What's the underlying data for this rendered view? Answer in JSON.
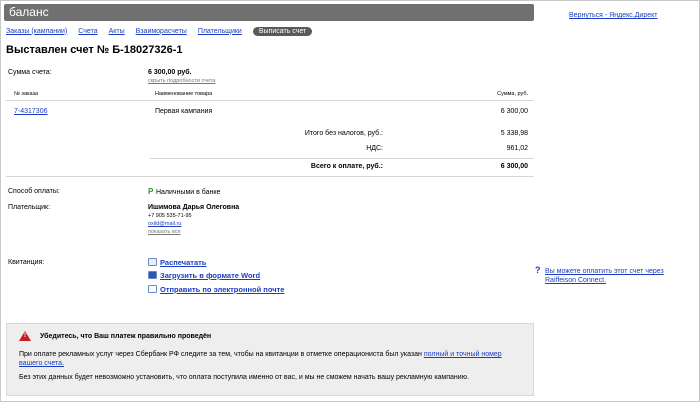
{
  "header": {
    "title": "баланс"
  },
  "back_link": "Вернуться - Яндекс.Директ",
  "nav": {
    "items": [
      "Заказы (кампании)",
      "Счета",
      "Акты",
      "Взаиморасчеты",
      "Плательщики"
    ],
    "active": "Выписать счет"
  },
  "page_title": "Выставлен счет № Б-18027326-1",
  "invoice": {
    "sum_label": "Сумма счета:",
    "sum_value": "6 300,00 руб.",
    "hide_details": "скрыть подробности счета",
    "table": {
      "col_order": "№ заказа",
      "col_name": "Наименование товара",
      "col_sum": "Сумма, руб.",
      "rows": [
        {
          "order": "7-4317306",
          "name": "Первая кампания",
          "sum": "6 300,00"
        }
      ]
    },
    "total_no_tax_label": "Итого без налогов, руб.:",
    "total_no_tax_value": "5 338,98",
    "vat_label": "НДС:",
    "vat_value": "961,02",
    "grand_total_label": "Всего к оплате, руб.:",
    "grand_total_value": "6 300,00"
  },
  "payment": {
    "method_label": "Способ оплаты:",
    "method_value": "Наличными в банке",
    "payer_label": "Плательщик:",
    "payer_name": "Ишимова Дарья Олеговна",
    "payer_phone": "+7 905 535-71-95",
    "payer_email": "oxild@mail.ru",
    "show_all": "показать все"
  },
  "receipt": {
    "label": "Квитанция:",
    "print": "Распечатать",
    "word": "Загрузить в формате Word",
    "email": "Отправить по электронной почте"
  },
  "raiffeisen": "Вы можете оплатить этот счет через Raiffeison Connect.",
  "notice": {
    "heading": "Убедитесь, что Ваш платеж правильно проведён",
    "text1": "При оплате рекламных услуг через Сбербанк РФ следите за тем, чтобы на квитанции в отметке операциониста был указан",
    "text1_link": "полный и точный номер вашего счета.",
    "text2": "Без этих данных будет невозможно установить, что оплата поступила именно от вас, и мы не сможем начать вашу рекламную кампанию."
  }
}
